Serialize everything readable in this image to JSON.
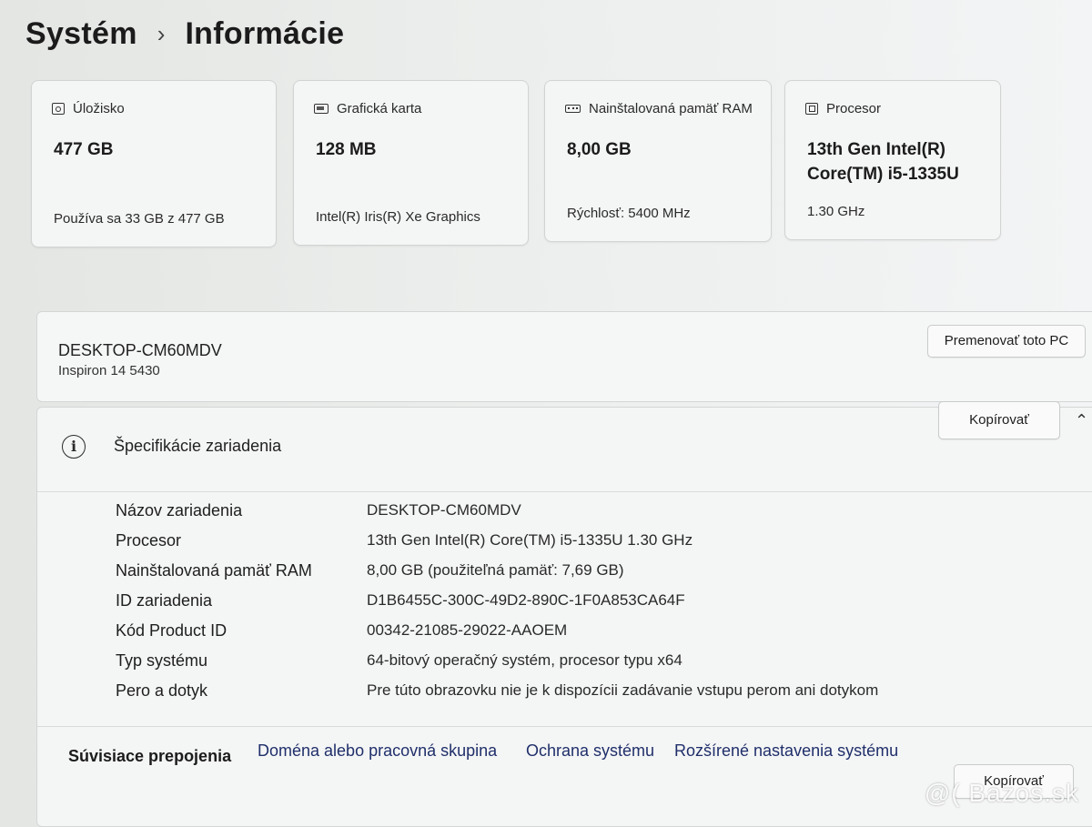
{
  "breadcrumb": {
    "parent": "Systém",
    "separator": "›",
    "current": "Informácie"
  },
  "cards": [
    {
      "icon": "storage-icon",
      "title": "Úložisko",
      "value": "477 GB",
      "detail": "Používa sa 33 GB z 477 GB"
    },
    {
      "icon": "graphics-card-icon",
      "title": "Grafická karta",
      "value": "128 MB",
      "detail": "Intel(R) Iris(R) Xe Graphics"
    },
    {
      "icon": "ram-icon",
      "title": "Nainštalovaná pamäť RAM",
      "value": "8,00 GB",
      "detail": "Rýchlosť: 5400 MHz"
    },
    {
      "icon": "processor-icon",
      "title": "Procesor",
      "value_line1": "13th Gen Intel(R)",
      "value_line2": "Core(TM) i5-1335U",
      "detail": "1.30 GHz"
    }
  ],
  "device": {
    "name": "DESKTOP-CM60MDV",
    "model": "Inspiron 14 5430",
    "rename_button": "Premenovať toto PC"
  },
  "specs": {
    "title": "Špecifikácie zariadenia",
    "copy_button": "Kopírovať",
    "rows": [
      {
        "label": "Názov zariadenia",
        "value": "DESKTOP-CM60MDV"
      },
      {
        "label": "Procesor",
        "value": "13th Gen Intel(R) Core(TM) i5-1335U   1.30 GHz"
      },
      {
        "label": "Nainštalovaná pamäť RAM",
        "value": "8,00 GB (použiteľná pamäť: 7,69 GB)"
      },
      {
        "label": "ID zariadenia",
        "value": "D1B6455C-300C-49D2-890C-1F0A853CA64F"
      },
      {
        "label": "Kód Product ID",
        "value": "00342-21085-29022-AAOEM"
      },
      {
        "label": "Typ systému",
        "value": "64-bitový operačný systém, procesor typu x64"
      },
      {
        "label": "Pero a dotyk",
        "value": "Pre túto obrazovku nie je k dispozícii zadávanie vstupu perom ani dotykom"
      }
    ]
  },
  "related": {
    "title": "Súvisiace prepojenia",
    "links": [
      "Doména alebo pracovná skupina",
      "Ochrana systému",
      "Rozšírené nastavenia systému"
    ]
  },
  "bottom_button": "Kopírovať",
  "watermark": "@( Bazos.sk"
}
